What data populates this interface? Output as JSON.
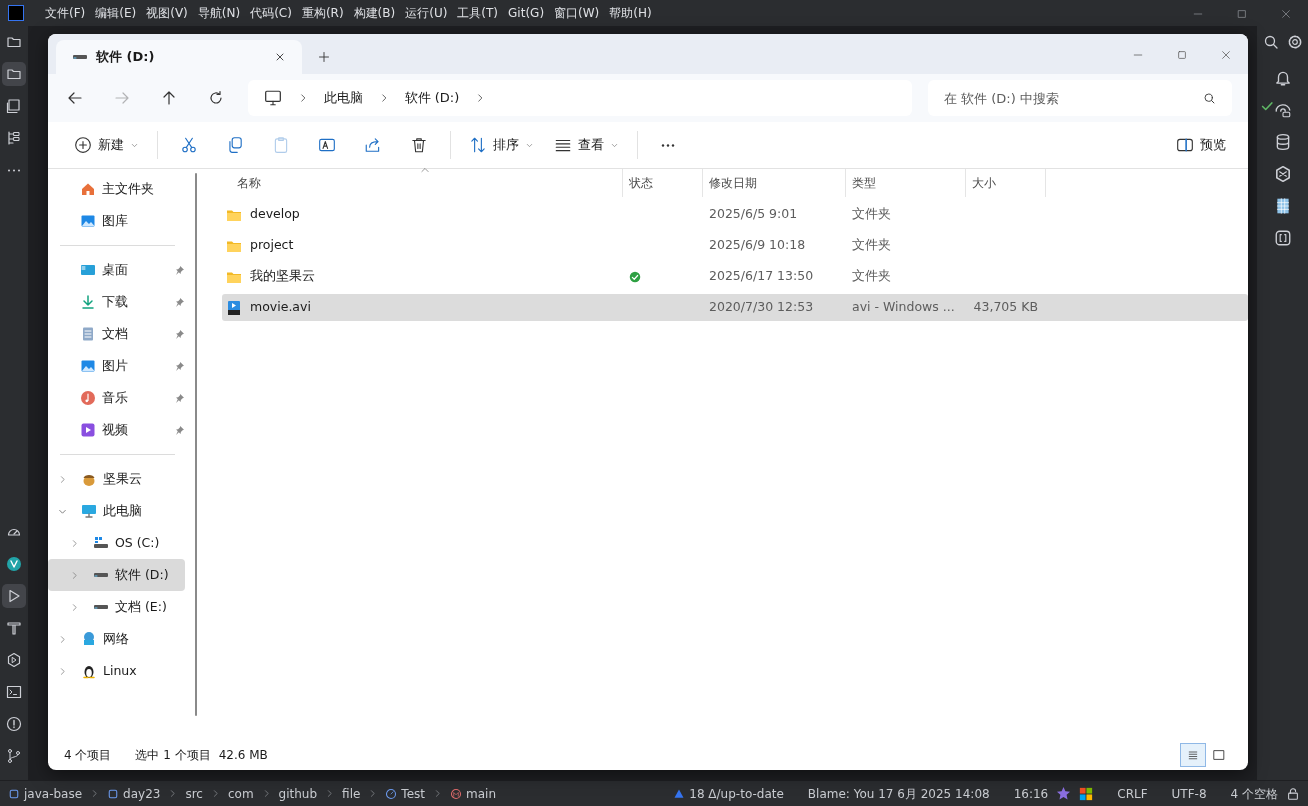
{
  "ide": {
    "menu": [
      "文件(F)",
      "编辑(E)",
      "视图(V)",
      "导航(N)",
      "代码(C)",
      "重构(R)",
      "构建(B)",
      "运行(U)",
      "工具(T)",
      "Git(G)",
      "窗口(W)",
      "帮助(H)"
    ],
    "left_tools": [
      {
        "kind": "folder",
        "selected": false
      },
      {
        "kind": "folder",
        "selected": true
      },
      {
        "kind": "commit",
        "selected": false
      },
      {
        "kind": "structure",
        "selected": false
      },
      {
        "kind": "more",
        "selected": false
      }
    ],
    "left_tools_bottom": [
      {
        "kind": "gauge",
        "selected": false
      },
      {
        "kind": "vue",
        "selected": false
      },
      {
        "kind": "run",
        "selected": true
      },
      {
        "kind": "build",
        "selected": false
      },
      {
        "kind": "services",
        "selected": false
      },
      {
        "kind": "terminal",
        "selected": false
      },
      {
        "kind": "problems",
        "selected": false
      },
      {
        "kind": "git",
        "selected": false
      }
    ],
    "right_tools": [
      {
        "kind": "bell"
      },
      {
        "kind": "ai"
      },
      {
        "kind": "database"
      },
      {
        "kind": "plugin"
      },
      {
        "kind": "grid"
      },
      {
        "kind": "braces"
      }
    ],
    "status_bar": {
      "path": [
        {
          "kind": "module",
          "label": "java-base"
        },
        {
          "kind": "module",
          "label": "day23"
        },
        {
          "kind": "dir",
          "label": "src"
        },
        {
          "kind": "dir",
          "label": "com"
        },
        {
          "kind": "dir",
          "label": "github"
        },
        {
          "kind": "dir",
          "label": "file"
        },
        {
          "kind": "class",
          "label": "Test"
        },
        {
          "kind": "method",
          "label": "main"
        }
      ],
      "vcs": "18 Δ/up-to-date",
      "blame": "Blame: You 17 6月 2025 14:08",
      "position": "16:16",
      "line_sep": "CRLF",
      "encoding": "UTF-8",
      "indent": "4 个空格"
    }
  },
  "explorer": {
    "tab": {
      "title": "软件 (D:)"
    },
    "nav": [
      {
        "kind": "back",
        "disabled": false
      },
      {
        "kind": "forward",
        "disabled": true
      },
      {
        "kind": "up",
        "disabled": false
      },
      {
        "kind": "refresh",
        "disabled": false
      }
    ],
    "breadcrumb": [
      "此电脑",
      "软件 (D:)"
    ],
    "search": {
      "placeholder": "在 软件 (D:) 中搜索"
    },
    "toolbar": [
      {
        "kind": "new",
        "label": "新建",
        "disabled": false
      },
      {
        "kind": "cut",
        "disabled": false
      },
      {
        "kind": "copy",
        "disabled": false
      },
      {
        "kind": "paste",
        "disabled": true
      },
      {
        "kind": "rename",
        "disabled": false
      },
      {
        "kind": "share",
        "disabled": false
      },
      {
        "kind": "delete",
        "disabled": false
      },
      {
        "kind": "sort",
        "label": "排序",
        "disabled": false
      },
      {
        "kind": "view",
        "label": "查看",
        "disabled": false
      },
      {
        "kind": "more",
        "disabled": false
      }
    ],
    "preview": {
      "label": "预览"
    },
    "quick": [
      {
        "kind": "home",
        "label": "主文件夹"
      },
      {
        "kind": "gallery",
        "label": "图库"
      }
    ],
    "pinned": [
      {
        "kind": "desktop",
        "label": "桌面",
        "pinned": true
      },
      {
        "kind": "download",
        "label": "下载",
        "pinned": true
      },
      {
        "kind": "document",
        "label": "文档",
        "pinned": true
      },
      {
        "kind": "picture",
        "label": "图片",
        "pinned": true
      },
      {
        "kind": "music",
        "label": "音乐",
        "pinned": true
      },
      {
        "kind": "video",
        "label": "视频",
        "pinned": true
      }
    ],
    "tree": [
      {
        "kind": "nut",
        "label": "坚果云",
        "expanded": false,
        "selected": false
      },
      {
        "kind": "pc",
        "label": "此电脑",
        "expanded": true,
        "selected": false,
        "children": [
          {
            "kind": "osdrive",
            "label": "OS (C:)",
            "expanded": false,
            "selected": false
          },
          {
            "kind": "drive",
            "label": "软件 (D:)",
            "expanded": false,
            "selected": true
          },
          {
            "kind": "drive",
            "label": "文档 (E:)",
            "expanded": false,
            "selected": false
          }
        ]
      },
      {
        "kind": "network",
        "label": "网络",
        "expanded": false,
        "selected": false
      },
      {
        "kind": "linux",
        "label": "Linux",
        "expanded": false,
        "selected": false
      }
    ],
    "columns": [
      "名称",
      "状态",
      "修改日期",
      "类型",
      "大小"
    ],
    "rows": [
      {
        "kind": "folder",
        "name": "develop",
        "synced": false,
        "modified": "2025/6/5 9:01",
        "type": "文件夹",
        "size": "",
        "selected": false
      },
      {
        "kind": "folder",
        "name": "project",
        "synced": false,
        "modified": "2025/6/9 10:18",
        "type": "文件夹",
        "size": "",
        "selected": false
      },
      {
        "kind": "folder",
        "name": "我的坚果云",
        "synced": true,
        "modified": "2025/6/17 13:50",
        "type": "文件夹",
        "size": "",
        "selected": false
      },
      {
        "kind": "video",
        "name": "movie.avi",
        "synced": false,
        "modified": "2020/7/30 12:53",
        "type": "avi - Windows ...",
        "size": "43,705 KB",
        "selected": true
      }
    ],
    "status": {
      "count": "4 个项目",
      "selection": "选中 1 个项目",
      "size": "42.6 MB"
    },
    "views": [
      {
        "kind": "details",
        "selected": true
      },
      {
        "kind": "tiles",
        "selected": false
      }
    ]
  }
}
